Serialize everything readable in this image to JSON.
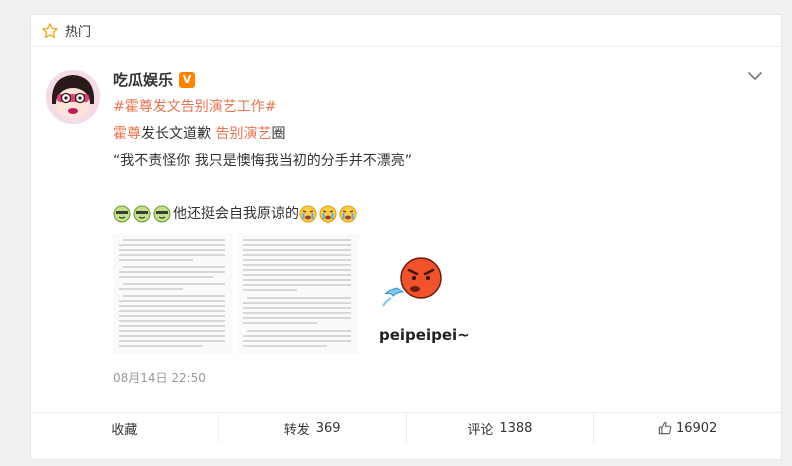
{
  "section": {
    "label": "热门",
    "icon": "star-outline-icon"
  },
  "post": {
    "username": "吃瓜娱乐",
    "verified_badge": "V",
    "topic": "#霍尊发文告别演艺工作#",
    "line2": {
      "tag1": "霍尊",
      "text1": "发长文道歉 ",
      "tag2": "告别演艺",
      "text2": "圈"
    },
    "quote": "“我不责怪你 我只是懊悔我当初的分手并不漂亮”",
    "emotion_line": {
      "text": "他还挺会自我原谅的"
    },
    "sticker_text": "peipeipei~",
    "timestamp": "08月14日 22:50"
  },
  "actions": {
    "favorite": {
      "label": "收藏"
    },
    "repost": {
      "label": "转发",
      "count": "369"
    },
    "comment": {
      "label": "评论",
      "count": "1388"
    },
    "like": {
      "count": "16902"
    }
  },
  "colors": {
    "accent": "#eb7350",
    "badge": "#ff8200",
    "timestamp": "#999999"
  }
}
